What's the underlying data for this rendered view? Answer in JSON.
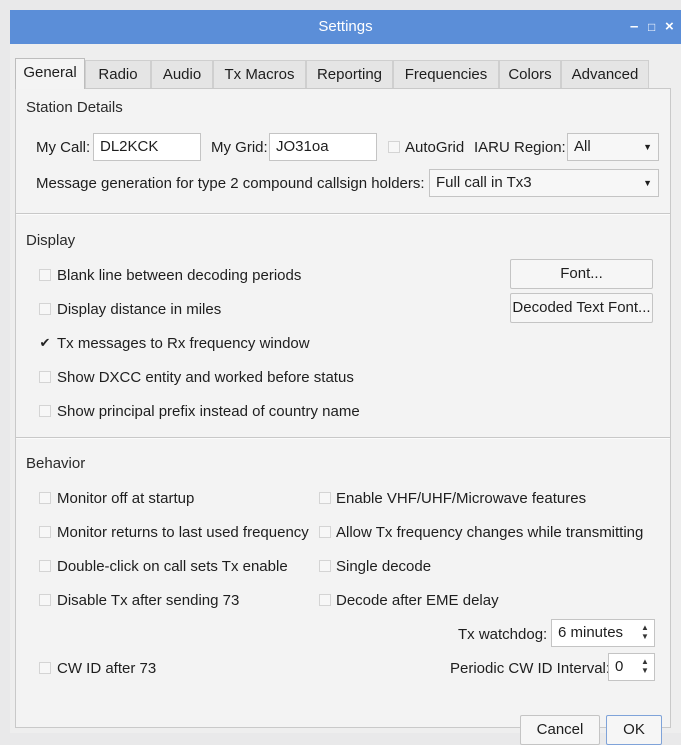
{
  "window": {
    "title": "Settings",
    "minimize_glyph": "–",
    "maximize_glyph": "□",
    "close_glyph": "×"
  },
  "tabs": [
    {
      "label": "General",
      "active": true
    },
    {
      "label": "Radio",
      "active": false
    },
    {
      "label": "Audio",
      "active": false
    },
    {
      "label": "Tx Macros",
      "active": false
    },
    {
      "label": "Reporting",
      "active": false
    },
    {
      "label": "Frequencies",
      "active": false
    },
    {
      "label": "Colors",
      "active": false
    },
    {
      "label": "Advanced",
      "active": false
    }
  ],
  "station": {
    "section_title": "Station Details",
    "my_call_label": "My Call:",
    "my_call_value": "DL2KCK",
    "my_grid_label": "My Grid:",
    "my_grid_value": "JO31oa",
    "autogrid_label": "AutoGrid",
    "autogrid_checked": false,
    "iaru_label": "IARU Region:",
    "iaru_value": "All",
    "msg_gen_label": "Message generation for type 2 compound callsign holders:",
    "msg_gen_value": "Full call in Tx3"
  },
  "display": {
    "section_title": "Display",
    "options": [
      {
        "label": "Blank line between decoding periods",
        "checked": false
      },
      {
        "label": "Display distance in miles",
        "checked": false
      },
      {
        "label": "Tx messages to Rx frequency window",
        "checked": true
      },
      {
        "label": "Show DXCC entity and worked before status",
        "checked": false
      },
      {
        "label": "Show principal prefix instead of country name",
        "checked": false
      }
    ],
    "font_button": "Font...",
    "decoded_font_button": "Decoded Text Font..."
  },
  "behavior": {
    "section_title": "Behavior",
    "left_options": [
      {
        "label": "Monitor off at startup",
        "checked": false
      },
      {
        "label": "Monitor returns to last used frequency",
        "checked": false
      },
      {
        "label": "Double-click on call sets Tx enable",
        "checked": false
      },
      {
        "label": "Disable Tx after sending 73",
        "checked": false
      }
    ],
    "right_options": [
      {
        "label": "Enable VHF/UHF/Microwave features",
        "checked": false
      },
      {
        "label": "Allow Tx frequency changes while transmitting",
        "checked": false
      },
      {
        "label": "Single decode",
        "checked": false
      },
      {
        "label": "Decode after EME delay",
        "checked": false
      }
    ],
    "tx_watchdog_label": "Tx watchdog:",
    "tx_watchdog_value": "6 minutes",
    "cw_id_label": "CW ID after 73",
    "cw_id_checked": false,
    "periodic_cw_label": "Periodic CW ID Interval:",
    "periodic_cw_value": "0"
  },
  "footer": {
    "cancel_label": "Cancel",
    "ok_label": "OK"
  },
  "colors": {
    "titlebar": "#5b8ed8",
    "window_bg": "#eeeeee"
  }
}
